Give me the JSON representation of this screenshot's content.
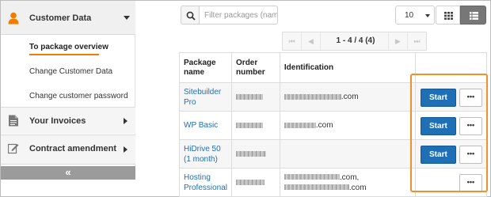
{
  "sidebar": {
    "customer_data": "Customer Data",
    "items": [
      {
        "label": "To package overview",
        "active": true
      },
      {
        "label": "Change Customer Data",
        "active": false
      },
      {
        "label": "Change customer password",
        "active": false
      }
    ],
    "invoices": "Your Invoices",
    "contract": "Contract amendment",
    "collapse_icon": "«",
    "accent_color": "#f07d00"
  },
  "toolbar": {
    "search_placeholder": "Filter packages (nam",
    "per_page": "10",
    "grid_icon": "grid-view-icon",
    "list_icon": "list-view-icon"
  },
  "pager": {
    "first": "⏮",
    "prev": "◀",
    "info": "1 - 4 / 4 (4)",
    "next": "▶",
    "last": "⏭"
  },
  "table": {
    "headers": [
      "Package name",
      "Order number",
      "Identification",
      ""
    ],
    "rows": [
      {
        "name": "Sitebuilder Pro",
        "ident_suffix": ".com",
        "has_start": true
      },
      {
        "name": "WP Basic",
        "ident_suffix": ".com",
        "has_start": true
      },
      {
        "name": "HiDrive 50 (1 month)",
        "ident_suffix": "",
        "has_start": true
      },
      {
        "name": "Hosting Professional",
        "ident_suffix": ".com,",
        "ident_suffix2": ".com",
        "has_start": false
      }
    ],
    "start_label": "Start",
    "more_label": "•••"
  },
  "colors": {
    "primary": "#1e6fb5",
    "highlight": "#f0922c"
  }
}
